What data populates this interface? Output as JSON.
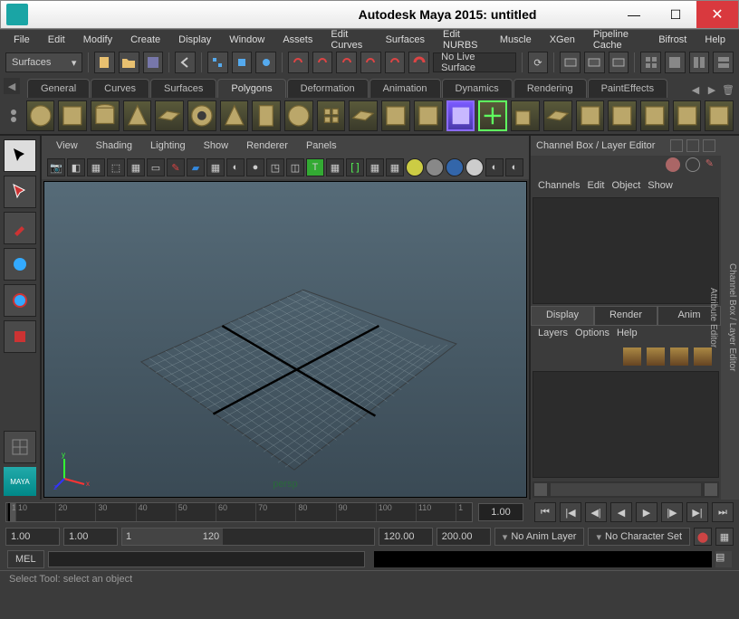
{
  "window": {
    "title": "Autodesk Maya 2015: untitled"
  },
  "menubar": [
    "File",
    "Edit",
    "Modify",
    "Create",
    "Display",
    "Window",
    "Assets",
    "Edit Curves",
    "Surfaces",
    "Edit NURBS",
    "Muscle",
    "XGen",
    "Pipeline Cache",
    "Bifrost",
    "Help"
  ],
  "module_dropdown": "Surfaces",
  "live_surface": "No Live Surface",
  "shelf_tabs": [
    "General",
    "Curves",
    "Surfaces",
    "Polygons",
    "Deformation",
    "Animation",
    "Dynamics",
    "Rendering",
    "PaintEffects"
  ],
  "shelf_active": "Polygons",
  "viewport_menus": [
    "View",
    "Shading",
    "Lighting",
    "Show",
    "Renderer",
    "Panels"
  ],
  "viewport_camera": "persp",
  "timeline": {
    "start": 1,
    "ticks": [
      10,
      20,
      30,
      40,
      50,
      60,
      70,
      80,
      90,
      100,
      110,
      1
    ],
    "current": "1.00"
  },
  "range": {
    "start": "1.00",
    "inner_start": "1.00",
    "inner_end_a": "1",
    "inner_end": "120",
    "end": "120.00",
    "max": "200.00"
  },
  "anim_layer": "No Anim Layer",
  "char_set": "No Character Set",
  "mel_label": "MEL",
  "status_text": "Select Tool: select an object",
  "channel_box": {
    "title": "Channel Box / Layer Editor",
    "menus": [
      "Channels",
      "Edit",
      "Object",
      "Show"
    ],
    "tabs": [
      "Display",
      "Render",
      "Anim"
    ],
    "tab_active": "Display",
    "layer_menus": [
      "Layers",
      "Options",
      "Help"
    ]
  },
  "side_tabs": [
    "Channel Box / Layer Editor",
    "Attribute Editor"
  ]
}
